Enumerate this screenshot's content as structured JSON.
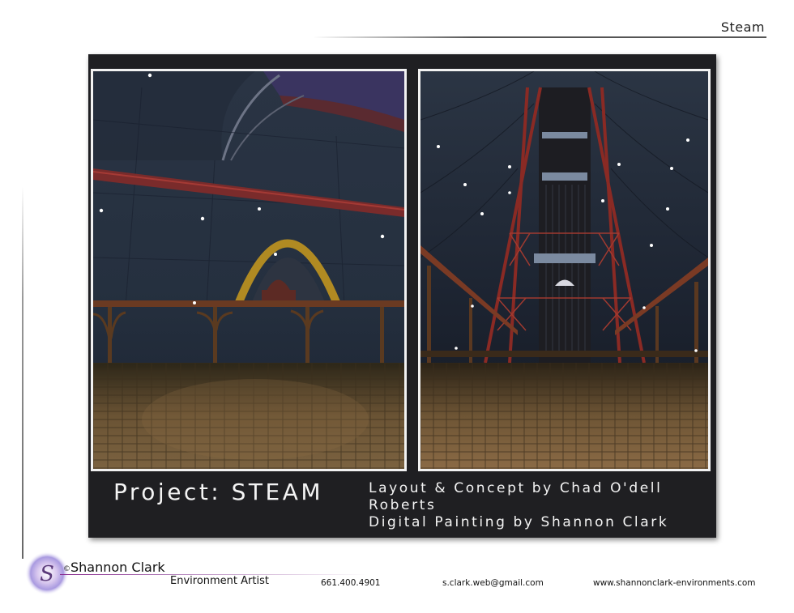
{
  "header": {
    "title": "Steam"
  },
  "board": {
    "project_title": "Project: STEAM",
    "credits": [
      "Layout & Concept by Chad O'dell",
      "Roberts",
      "Digital Painting by Shannon Clark"
    ],
    "images": [
      {
        "subject": "domed hall interior with railing and arched doorway"
      },
      {
        "subject": "vertical view of red steel tower with caged lift"
      }
    ]
  },
  "footer": {
    "copyright_symbol": "©",
    "name": "Shannon Clark",
    "role": "Environment Artist",
    "phone": "661.400.4901",
    "email": "s.clark.web@gmail.com",
    "website": "www.shannonclark-environments.com",
    "logo_letter": "S"
  },
  "colors": {
    "board_background": "#1f1f22",
    "accent_purple": "#8a2d8f",
    "panel_border": "#f2f2f2"
  }
}
